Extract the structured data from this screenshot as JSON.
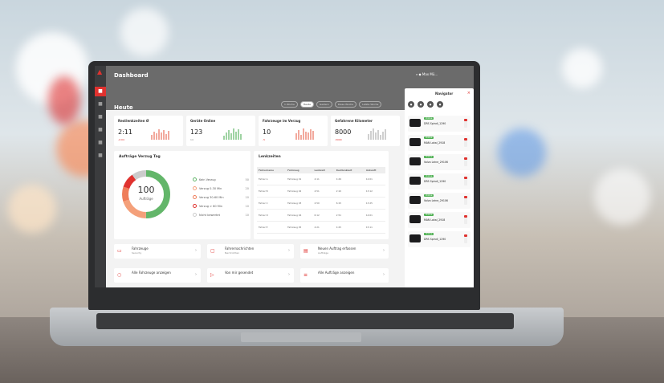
{
  "app": {
    "page_title": "Dashboard",
    "section_title": "Heute",
    "filters": [
      "1 Woche",
      "Heute",
      "Gestern",
      "Diese Woche",
      "Letzte Woche"
    ],
    "user": "Max Mü…"
  },
  "sidebar": {
    "items": [
      "home",
      "truck",
      "list",
      "map",
      "settings",
      "more"
    ]
  },
  "kpis": [
    {
      "title": "Restlenkzeiten Ø",
      "value": "2:11",
      "sub": "-0:04"
    },
    {
      "title": "Geräte Online",
      "value": "123",
      "sub": "14"
    },
    {
      "title": "Fahrzeuge im Verzug",
      "value": "10",
      "sub": "-5"
    },
    {
      "title": "Gefahrene Kilometer",
      "value": "8000",
      "sub": "-5000"
    }
  ],
  "orders": {
    "title": "Aufträge Verzug Tag",
    "total": "100",
    "total_label": "Aufträge",
    "legend": [
      {
        "label": "Kein Verzug",
        "count": "50",
        "color": "#63b66a"
      },
      {
        "label": "Verzug 0-30 Min",
        "count": "20",
        "color": "#f4a07a"
      },
      {
        "label": "Verzug 30-60 Min",
        "count": "10",
        "color": "#ef7d5a"
      },
      {
        "label": "Verzug > 60 Min",
        "count": "10",
        "color": "#e0322f"
      },
      {
        "label": "Nicht bewertet",
        "count": "10",
        "color": "#cccccc"
      }
    ]
  },
  "lenkzeiten": {
    "title": "Lenkzeiten",
    "columns": [
      "Fahrername",
      "Fahrzeug",
      "Lenkzeit",
      "Restlenkzeit",
      "Ankunft"
    ],
    "rows": [
      [
        "Fahrer A",
        "Fahrzeug 01",
        "4:11",
        "4:49",
        "12:01"
      ],
      [
        "Fahrer B",
        "Fahrzeug 02",
        "4:51",
        "2:10",
        "13:12"
      ],
      [
        "Fahrer C",
        "Fahrzeug 03",
        "2:50",
        "6:15",
        "13:25"
      ],
      [
        "Fahrer D",
        "Fahrzeug 04",
        "6:12",
        "2:51",
        "14:01"
      ],
      [
        "Fahrer E",
        "Fahrzeug 05",
        "4:21",
        "4:25",
        "15:11"
      ]
    ]
  },
  "actions": [
    {
      "title": "Fahrzeuge",
      "sub": "Security",
      "icon": "truck-icon"
    },
    {
      "title": "Fahrernachrichten",
      "sub": "Nachrichten",
      "icon": "message-icon"
    },
    {
      "title": "Neuen Auftrag erfassen",
      "sub": "Aufträge",
      "icon": "clipboard-icon"
    },
    {
      "title": "Alle Fahrzeuge anzeigen",
      "sub": "",
      "icon": "search-icon"
    },
    {
      "title": "Von mir gesendet",
      "sub": "",
      "icon": "send-icon"
    },
    {
      "title": "Alle Aufträge anzeigen",
      "sub": "",
      "icon": "list-icon"
    }
  ],
  "navigator": {
    "title": "Navigator",
    "items": [
      {
        "badge": "Online",
        "name": "DRS Spindl_1290"
      },
      {
        "badge": "Online",
        "name": "MAN Lokal_2918"
      },
      {
        "badge": "Online",
        "name": "Volvo Leine_29106"
      },
      {
        "badge": "Online",
        "name": "DRS Spindl_1290"
      },
      {
        "badge": "Online",
        "name": "Volvo Leine_29106"
      },
      {
        "badge": "Online",
        "name": "MAN Lokal_2918"
      },
      {
        "badge": "Online",
        "name": "DRS Spindl_1290"
      }
    ]
  },
  "colors": {
    "brand": "#e0322f",
    "topbar": "#6b6b6b",
    "green": "#63b66a"
  }
}
